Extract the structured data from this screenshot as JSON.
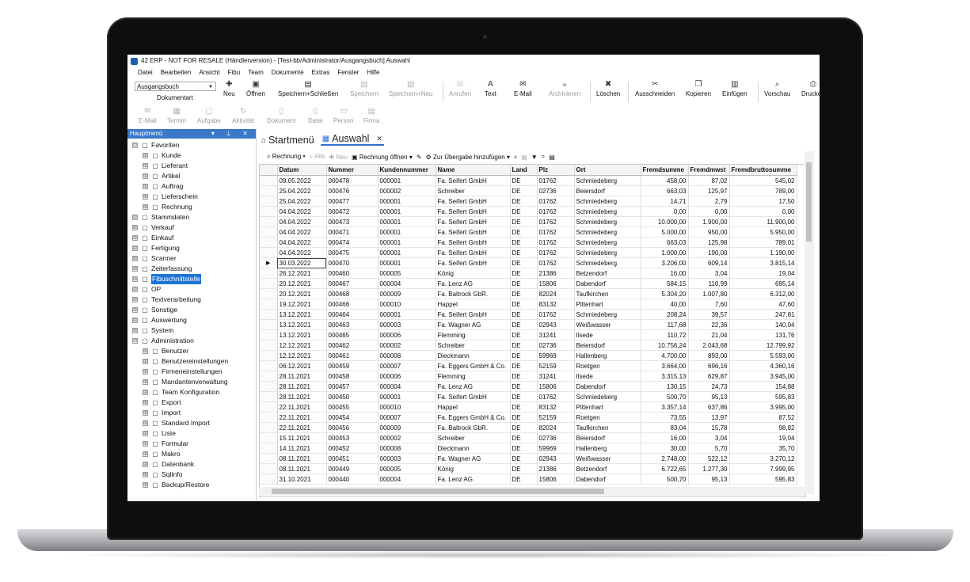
{
  "window": {
    "title": "42 ERP - NOT FOR RESALE (Händlerversion) - [Test-bb/Administrator/Ausgangsbuch] Auswahl"
  },
  "menu": [
    "Datei",
    "Bearbeiten",
    "Ansicht",
    "Fibu",
    "Team",
    "Dokumente",
    "Extras",
    "Fenster",
    "Hilfe"
  ],
  "ribbon": {
    "combo_value": "Ausgangsbuch",
    "combo_label": "Dokumentart",
    "neu": "Neu",
    "oeffnen": "Öffnen",
    "speichern_schliessen": "Speichern+Schließen",
    "speichern": "Speichern",
    "speichern_neu": "Speichern+Neu",
    "anrufen": "Anrufen",
    "text": "Text",
    "email": "E-Mail",
    "archivieren": "Archivieren",
    "loeschen": "Löschen",
    "ausschneiden": "Ausschneiden",
    "kopieren": "Kopieren",
    "einfuegen": "Einfügen",
    "vorschau": "Vorschau",
    "drucken": "Drucken"
  },
  "ribbon2": [
    "E-Mail",
    "Termin",
    "Aufgabe",
    "Aktivität",
    "Dokument",
    "Datei",
    "Person",
    "Firma"
  ],
  "panel": {
    "title": "Hauptmenü"
  },
  "tree": [
    {
      "label": "Favoriten",
      "level": 0,
      "exp": "⊟"
    },
    {
      "label": "Kunde",
      "level": 1,
      "exp": "⊞"
    },
    {
      "label": "Lieferant",
      "level": 1,
      "exp": "⊞"
    },
    {
      "label": "Artikel",
      "level": 1,
      "exp": "⊞"
    },
    {
      "label": "Auftrag",
      "level": 1,
      "exp": "⊞"
    },
    {
      "label": "Lieferschein",
      "level": 1,
      "exp": "⊞"
    },
    {
      "label": "Rechnung",
      "level": 1,
      "exp": "⊞"
    },
    {
      "label": "Stammdaten",
      "level": 0,
      "exp": "⊞"
    },
    {
      "label": "Verkauf",
      "level": 0,
      "exp": "⊞"
    },
    {
      "label": "Einkauf",
      "level": 0,
      "exp": "⊞"
    },
    {
      "label": "Fertigung",
      "level": 0,
      "exp": "⊞"
    },
    {
      "label": "Scanner",
      "level": 0,
      "exp": "⊞"
    },
    {
      "label": "Zeiterfassung",
      "level": 0,
      "exp": "⊞"
    },
    {
      "label": "Fibuschnittstelle",
      "level": 0,
      "exp": "⊞",
      "selected": true
    },
    {
      "label": "OP",
      "level": 0,
      "exp": "⊞"
    },
    {
      "label": "Textverarbeitung",
      "level": 0,
      "exp": "⊞"
    },
    {
      "label": "Sonstige",
      "level": 0,
      "exp": "⊞"
    },
    {
      "label": "Auswertung",
      "level": 0,
      "exp": "⊞"
    },
    {
      "label": "System",
      "level": 0,
      "exp": "⊞"
    },
    {
      "label": "Administration",
      "level": 0,
      "exp": "⊟"
    },
    {
      "label": "Benutzer",
      "level": 1,
      "exp": "⊞"
    },
    {
      "label": "Benutzereinstellungen",
      "level": 1,
      "exp": "⊞"
    },
    {
      "label": "Firmeneinstellungen",
      "level": 1,
      "exp": "⊞"
    },
    {
      "label": "Mandantenverwaltung",
      "level": 1,
      "exp": "⊞"
    },
    {
      "label": "Team Konfiguration",
      "level": 1,
      "exp": "⊞"
    },
    {
      "label": "Export",
      "level": 1,
      "exp": "⊞"
    },
    {
      "label": "Import",
      "level": 1,
      "exp": "⊞"
    },
    {
      "label": "Standard Import",
      "level": 1,
      "exp": "⊞"
    },
    {
      "label": "Liste",
      "level": 1,
      "exp": "⊞"
    },
    {
      "label": "Formular",
      "level": 1,
      "exp": "⊞"
    },
    {
      "label": "Makro",
      "level": 1,
      "exp": "⊞"
    },
    {
      "label": "Datenbank",
      "level": 1,
      "exp": "⊞"
    },
    {
      "label": "SqlInfo",
      "level": 1,
      "exp": "⊞"
    },
    {
      "label": "Backup/Restore",
      "level": 1,
      "exp": "⊞"
    }
  ],
  "tabs": {
    "start": "Startmenü",
    "auswahl": "Auswahl"
  },
  "gridtool": {
    "rechnung": "Rechnung",
    "alle": "Alle",
    "neu": "Neu",
    "oeffnen": "Rechnung öffnen",
    "uebergabe": "Zur Übergabe hinzufügen"
  },
  "table": {
    "columns": [
      "Datum",
      "Nummer",
      "Kundennummer",
      "Name",
      "Land",
      "Plz",
      "Ort",
      "Fremdsumme",
      "Fremdmwst",
      "Fremdbruttosumme"
    ],
    "current_row": 8,
    "rows": [
      [
        "09.05.2022",
        "000478",
        "000001",
        "Fa. Seifert GmbH",
        "DE",
        "01762",
        "Schmiedeberg",
        "458,00",
        "87,02",
        "545,02"
      ],
      [
        "25.04.2022",
        "000476",
        "000002",
        "Schreiber",
        "DE",
        "02736",
        "Beiersdorf",
        "663,03",
        "125,97",
        "789,00"
      ],
      [
        "25.04.2022",
        "000477",
        "000001",
        "Fa. Seifert GmbH",
        "DE",
        "01762",
        "Schmiedeberg",
        "14,71",
        "2,79",
        "17,50"
      ],
      [
        "04.04.2022",
        "000472",
        "000001",
        "Fa. Seifert GmbH",
        "DE",
        "01762",
        "Schmiedeberg",
        "0,00",
        "0,00",
        "0,00"
      ],
      [
        "04.04.2022",
        "000473",
        "000001",
        "Fa. Seifert GmbH",
        "DE",
        "01762",
        "Schmiedeberg",
        "10.000,00",
        "1.900,00",
        "11.900,00"
      ],
      [
        "04.04.2022",
        "000471",
        "000001",
        "Fa. Seifert GmbH",
        "DE",
        "01762",
        "Schmiedeberg",
        "5.000,00",
        "950,00",
        "5.950,00"
      ],
      [
        "04.04.2022",
        "000474",
        "000001",
        "Fa. Seifert GmbH",
        "DE",
        "01762",
        "Schmiedeberg",
        "663,03",
        "125,98",
        "789,01"
      ],
      [
        "04.04.2022",
        "000475",
        "000001",
        "Fa. Seifert GmbH",
        "DE",
        "01762",
        "Schmiedeberg",
        "1.000,00",
        "190,00",
        "1.190,00"
      ],
      [
        "30.03.2022",
        "000470",
        "000001",
        "Fa. Seifert GmbH",
        "DE",
        "01762",
        "Schmiedeberg",
        "3.206,00",
        "609,14",
        "3.815,14"
      ],
      [
        "26.12.2021",
        "000460",
        "000005",
        "König",
        "DE",
        "21386",
        "Betzendorf",
        "16,00",
        "3,04",
        "19,04"
      ],
      [
        "20.12.2021",
        "000467",
        "000004",
        "Fa. Lenz AG",
        "DE",
        "15806",
        "Dabendorf",
        "584,15",
        "110,99",
        "695,14"
      ],
      [
        "20.12.2021",
        "000468",
        "000009",
        "Fa. Baltrock GbR.",
        "DE",
        "82024",
        "Taufkirchen",
        "5.304,20",
        "1.007,80",
        "6.312,00"
      ],
      [
        "19.12.2021",
        "000466",
        "000010",
        "Happel",
        "DE",
        "83132",
        "Pittenhart",
        "40,00",
        "7,60",
        "47,60"
      ],
      [
        "13.12.2021",
        "000464",
        "000001",
        "Fa. Seifert GmbH",
        "DE",
        "01762",
        "Schmiedeberg",
        "208,24",
        "39,57",
        "247,81"
      ],
      [
        "13.12.2021",
        "000463",
        "000003",
        "Fa. Wagner AG",
        "DE",
        "02943",
        "Weißwasser",
        "117,68",
        "22,36",
        "140,04"
      ],
      [
        "13.12.2021",
        "000465",
        "000006",
        "Flemming",
        "DE",
        "31241",
        "Ilsede",
        "110,72",
        "21,04",
        "131,76"
      ],
      [
        "12.12.2021",
        "000462",
        "000002",
        "Schreiber",
        "DE",
        "02736",
        "Beiersdorf",
        "10.756,24",
        "2.043,68",
        "12.799,92"
      ],
      [
        "12.12.2021",
        "000461",
        "000008",
        "Dieckmann",
        "DE",
        "59969",
        "Hallenberg",
        "4.700,00",
        "893,00",
        "5.593,00"
      ],
      [
        "06.12.2021",
        "000459",
        "000007",
        "Fa. Eggers GmbH & Co.",
        "DE",
        "52159",
        "Roetgen",
        "3.664,00",
        "696,16",
        "4.360,16"
      ],
      [
        "28.11.2021",
        "000458",
        "000006",
        "Flemming",
        "DE",
        "31241",
        "Ilsede",
        "3.315,13",
        "629,87",
        "3.945,00"
      ],
      [
        "28.11.2021",
        "000457",
        "000004",
        "Fa. Lenz AG",
        "DE",
        "15806",
        "Dabendorf",
        "130,15",
        "24,73",
        "154,88"
      ],
      [
        "28.11.2021",
        "000450",
        "000001",
        "Fa. Seifert GmbH",
        "DE",
        "01762",
        "Schmiedeberg",
        "500,70",
        "95,13",
        "595,83"
      ],
      [
        "22.11.2021",
        "000455",
        "000010",
        "Happel",
        "DE",
        "83132",
        "Pittenhart",
        "3.357,14",
        "637,86",
        "3.995,00"
      ],
      [
        "22.11.2021",
        "000454",
        "000007",
        "Fa. Eggers GmbH & Co.",
        "DE",
        "52159",
        "Roetgen",
        "73,55",
        "13,97",
        "87,52"
      ],
      [
        "22.11.2021",
        "000456",
        "000009",
        "Fa. Baltrock GbR.",
        "DE",
        "82024",
        "Taufkirchen",
        "83,04",
        "15,78",
        "98,82"
      ],
      [
        "15.11.2021",
        "000453",
        "000002",
        "Schreiber",
        "DE",
        "02736",
        "Beiersdorf",
        "16,00",
        "3,04",
        "19,04"
      ],
      [
        "14.11.2021",
        "000452",
        "000008",
        "Dieckmann",
        "DE",
        "59969",
        "Hallenberg",
        "30,00",
        "5,70",
        "35,70"
      ],
      [
        "08.11.2021",
        "000451",
        "000003",
        "Fa. Wagner AG",
        "DE",
        "02943",
        "Weißwasser",
        "2.748,00",
        "522,12",
        "3.270,12"
      ],
      [
        "08.11.2021",
        "000449",
        "000005",
        "König",
        "DE",
        "21386",
        "Betzendorf",
        "6.722,65",
        "1.277,30",
        "7.999,95"
      ],
      [
        "31.10.2021",
        "000440",
        "000004",
        "Fa. Lenz AG",
        "DE",
        "15806",
        "Dabendorf",
        "500,70",
        "95,13",
        "595,83"
      ]
    ]
  },
  "colors": {
    "accent": "#1e73d6",
    "panel_header": "#3c78c8"
  }
}
